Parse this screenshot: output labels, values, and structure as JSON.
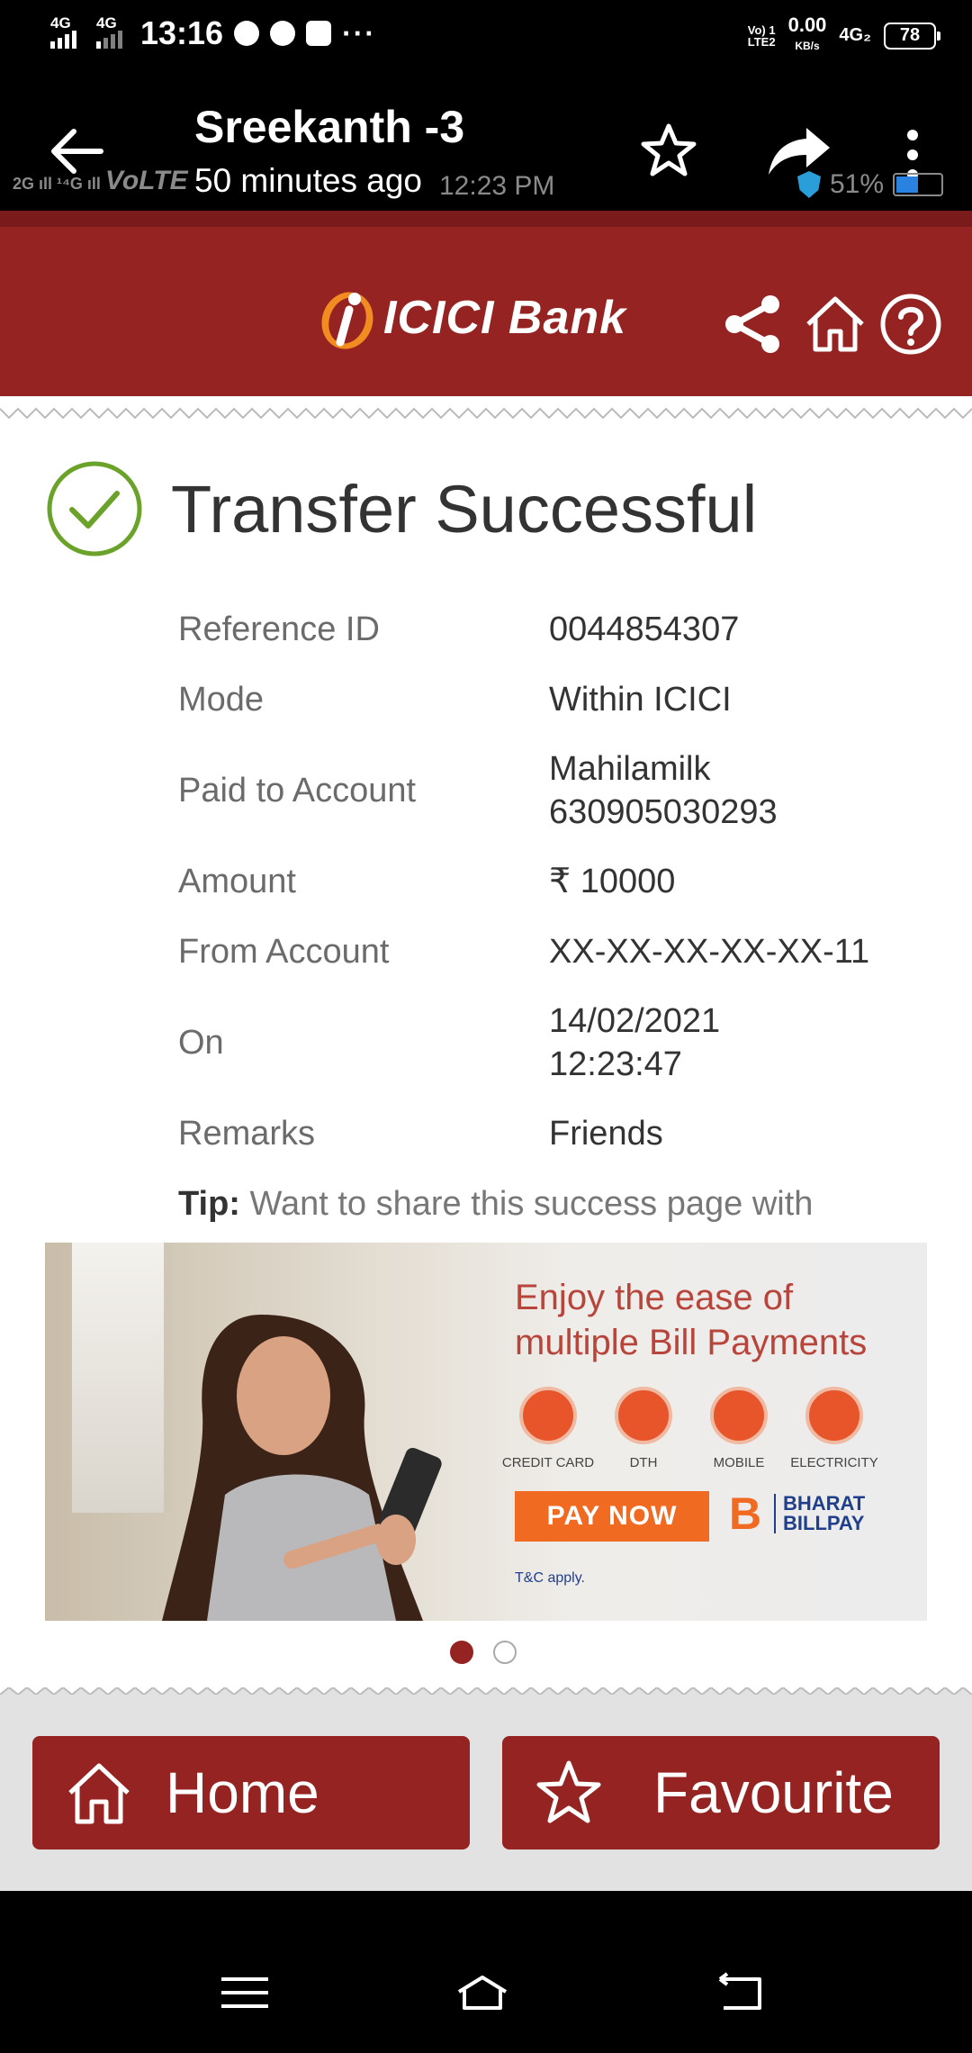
{
  "status_bar": {
    "net_left_1": "4G",
    "net_left_2": "4G",
    "time": "13:16",
    "more": "···",
    "volte_1": "Vo) 1",
    "volte_2": "LTE2",
    "speed_value": "0.00",
    "speed_unit": "KB/s",
    "net_right": "4G₂",
    "battery": "78"
  },
  "app_bar": {
    "title": "Sreekanth -3",
    "subtitle": "50 minutes ago",
    "underlay_left": "VoLTE",
    "underlay_time": "12:23 PM",
    "underlay_battery": "51%"
  },
  "bank_header": {
    "logo_text": "ICICI Bank"
  },
  "confirmation": {
    "title": "Transfer Successful",
    "rows": [
      {
        "label": "Reference ID",
        "value": "0044854307"
      },
      {
        "label": "Mode",
        "value": "Within ICICI"
      },
      {
        "label": "Paid to Account",
        "value": "Mahilamilk",
        "value2": "630905030293"
      },
      {
        "label": "Amount",
        "value": "₹ 10000"
      },
      {
        "label": "From Account",
        "value": "XX-XX-XX-XX-XX-11"
      },
      {
        "label": "On",
        "value": "14/02/2021",
        "value2": "12:23:47"
      },
      {
        "label": "Remarks",
        "value": "Friends"
      }
    ],
    "tip_label": "Tip:",
    "tip_text": " Want to share this success page with"
  },
  "banner": {
    "title_line1": "Enjoy the ease of",
    "title_line2": "multiple Bill Payments",
    "services": [
      "CREDIT CARD",
      "DTH",
      "MOBILE",
      "ELECTRICITY"
    ],
    "cta": "PAY NOW",
    "partner_line1": "BHARAT",
    "partner_line2": "BILLPAY",
    "terms": "T&C apply."
  },
  "carousel": {
    "current": 1,
    "total": 2
  },
  "actions": {
    "home_label": "Home",
    "favourite_label": "Favourite"
  },
  "colors": {
    "brand": "#942322",
    "success": "#6aa22a",
    "banner_accent": "#f06a22"
  }
}
